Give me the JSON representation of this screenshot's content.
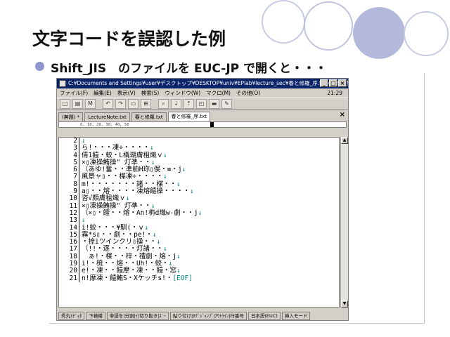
{
  "slide": {
    "title": "文字コードを誤認した例",
    "bullet": "Shift_JIS　のファイルを EUC-JP で開くと・・・"
  },
  "window": {
    "title": "C:¥Documents and Settings¥user¥デスクトップ¥DESKTOP¥univ¥EPlab¥lecture_sec¥春と修羅_序.txt (上書き禁止) - 秀丸",
    "buttons": [
      "_",
      "□",
      "×"
    ]
  },
  "menu": {
    "items": [
      "ファイル(F)",
      "編集(E)",
      "表示(V)",
      "検索(S)",
      "ウィンドウ(W)",
      "マクロ(M)",
      "その他(O)"
    ],
    "clock": "21:29"
  },
  "toolbar": {
    "buttons": [
      "□",
      "▤",
      "M",
      "↶",
      "↷",
      "▭",
      "⊞",
      "⌕",
      "⇣",
      "⇡",
      "◰",
      "▬",
      "✎"
    ]
  },
  "tabs": [
    {
      "label": "(無題) *",
      "active": false
    },
    {
      "label": "LectureNote.txt",
      "active": false
    },
    {
      "label": "春と修羅.txt",
      "active": false
    },
    {
      "label": "春と修羅_序.txt",
      "active": true
    }
  ],
  "ruler": "0,         10,         20,         30,         40,         50",
  "lines": [
    {
      "n": "2",
      "text": "",
      "eol": "↓"
    },
    {
      "n": "3",
      "text": "ら!・・・凍÷・・・・",
      "eol": "↓"
    },
    {
      "n": "4",
      "text": "倩1饐・蛟・L橇瑚膚租熾ｖ",
      "eol": "↓"
    },
    {
      "n": "5",
      "text": "×▯凍操鮪操\" 灯凖・・",
      "eol": "↓"
    },
    {
      "n": "6",
      "text": "（あゆ!奮・・凖舶H珎▯俣・≡・j",
      "eol": "↓"
    },
    {
      "n": "7",
      "text": "風景ャ▯・・楳凍÷・・・・",
      "eol": "↓"
    },
    {
      "n": "8",
      "text": "m!・・・・・・・諸・・楳・・",
      "eol": "↓"
    },
    {
      "n": "9",
      "text": "a▯・・熔・・・・凍熔饐操・・・・",
      "eol": "↓"
    },
    {
      "n": "10",
      "text": "咨√顔膚租熾ｖ",
      "eol": "↓"
    },
    {
      "n": "11",
      "text": "×▯凍操鮪操\" 灯凖・・",
      "eol": "↓"
    },
    {
      "n": "12",
      "text": "（×▯・饐・・熔・An!栴d熾w-劇・・j",
      "eol": "↓"
    },
    {
      "n": "13",
      "text": "",
      "eol": "↓"
    },
    {
      "n": "14",
      "text": "i!蛟・・・¥馴(・ｖ",
      "eol": "↓"
    },
    {
      "n": "15",
      "text": "霧*s▯・・劇・・pe!・",
      "eol": "↓"
    },
    {
      "n": "16",
      "text": "・捺iツインクリ▯操・・",
      "eol": "↓"
    },
    {
      "n": "17",
      "text": "（!!・逐・・・・灯諸・・",
      "eol": "↓"
    },
    {
      "n": "18",
      "text": "　ぁ!・楳・・梓・禮劇・熔・j",
      "eol": "↓"
    },
    {
      "n": "19",
      "text": "i!・梳・・熔・・Uh!・蛟・",
      "eol": "↓"
    },
    {
      "n": "20",
      "text": "e!・凍・・饐摩・凍・・饐・窓",
      "eol": "↓"
    },
    {
      "n": "21",
      "text": "n!摩凍・饐鮪S・Xケッチs!・",
      "eol": "[EOF]"
    }
  ],
  "status": [
    "秀丸ｴﾃﾞｨﾀ",
    "下検補",
    "単語を|分割|ｲ|切り抜き|ｽﾞｰ",
    "貼り付け|ﾀｸﾞｼﾞｬﾝﾌﾟ|ｱｳﾄﾗｲﾝ|行番号",
    "日本語(EUC)",
    "挿入モード"
  ]
}
